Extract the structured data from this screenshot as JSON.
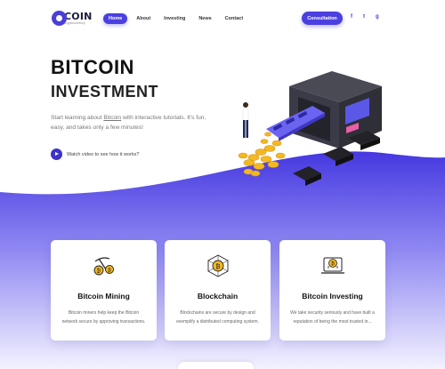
{
  "brand": {
    "name": "COIN",
    "tagline": "Cryptocurrency",
    "accent": "#4a40e0"
  },
  "nav": {
    "items": [
      {
        "label": "Home",
        "active": true
      },
      {
        "label": "About",
        "active": false
      },
      {
        "label": "Investing",
        "active": false
      },
      {
        "label": "News",
        "active": false
      },
      {
        "label": "Contact",
        "active": false
      }
    ]
  },
  "header": {
    "cta_label": "Consultation",
    "social": [
      "f",
      "t",
      "g"
    ]
  },
  "hero": {
    "title_line1": "BITCOIN",
    "title_line2": "INVESTMENT",
    "desc_before": "Start learning about ",
    "desc_link": "Bitcoin",
    "desc_after": " with interactive tutorials. It's fun, easy, and takes only a few minutes!",
    "video_label": "Watch video to see how it works?"
  },
  "cards": [
    {
      "icon": "bitcoin-mining-icon",
      "title": "Bitcoin Mining",
      "text": "Bitcoin miners help keep the Bitcoin network secure by approving transactions."
    },
    {
      "icon": "blockchain-icon",
      "title": "Blockchain",
      "text": "Blockchains are secure by design and exemplify a distributed computing system."
    },
    {
      "icon": "bitcoin-investing-icon",
      "title": "Bitcoin Investing",
      "text": "We take security seriously and have built a reputation of being the most trusted in..."
    }
  ]
}
